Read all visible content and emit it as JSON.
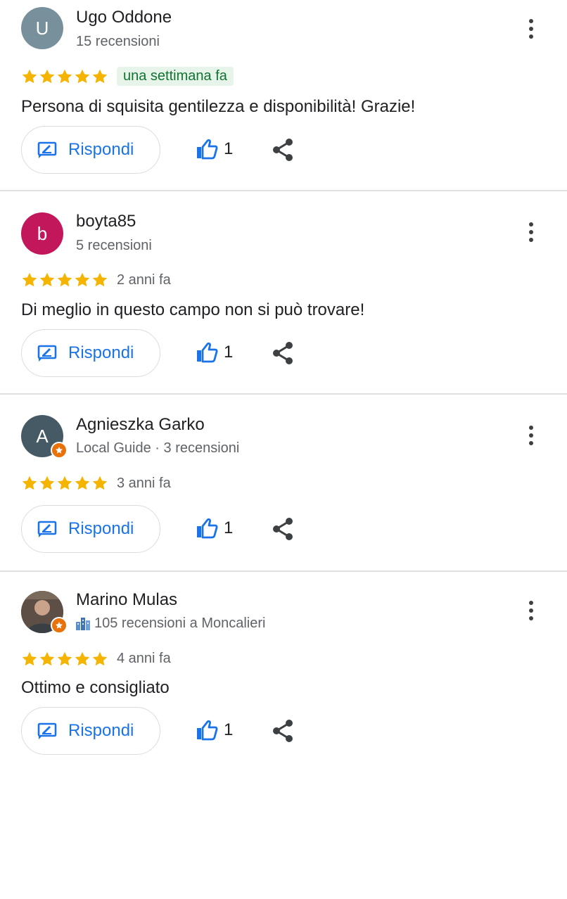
{
  "reviews": [
    {
      "author": "Ugo Oddone",
      "avatar_letter": "U",
      "avatar_color": "#78909c",
      "meta": "15 recensioni",
      "stars": 5,
      "date": "una settimana fa",
      "date_new": true,
      "text": "Persona di squisita gentilezza e disponibilità! Grazie!",
      "reply_label": "Rispondi",
      "likes": "1"
    },
    {
      "author": "boyta85",
      "avatar_letter": "b",
      "avatar_color": "#c2185b",
      "meta": "5 recensioni",
      "stars": 5,
      "date": "2 anni fa",
      "text": "Di meglio in questo campo non si può trovare!",
      "reply_label": "Rispondi",
      "likes": "1"
    },
    {
      "author": "Agnieszka Garko",
      "avatar_letter": "A",
      "avatar_color": "#455a64",
      "local_guide": true,
      "meta": "Local Guide · 3 recensioni",
      "stars": 5,
      "date": "3 anni fa",
      "text": "",
      "reply_label": "Rispondi",
      "likes": "1"
    },
    {
      "author": "Marino Mulas",
      "avatar_letter": "",
      "avatar_color": "#6d5a4e",
      "local_guide": true,
      "meta": "105 recensioni a Moncalieri",
      "meta_icon": "city-icon",
      "stars": 5,
      "date": "4 anni fa",
      "text": "Ottimo e consigliato",
      "reply_label": "Rispondi",
      "likes": "1"
    }
  ],
  "colors": {
    "star": "#f4b400",
    "accent": "#1a73e8",
    "local_guide_badge": "#e8710a"
  },
  "icons": [
    "more-vert-icon",
    "star-icon",
    "reply-icon",
    "thumb-up-icon",
    "share-icon",
    "local-guide-badge-icon",
    "city-icon"
  ]
}
